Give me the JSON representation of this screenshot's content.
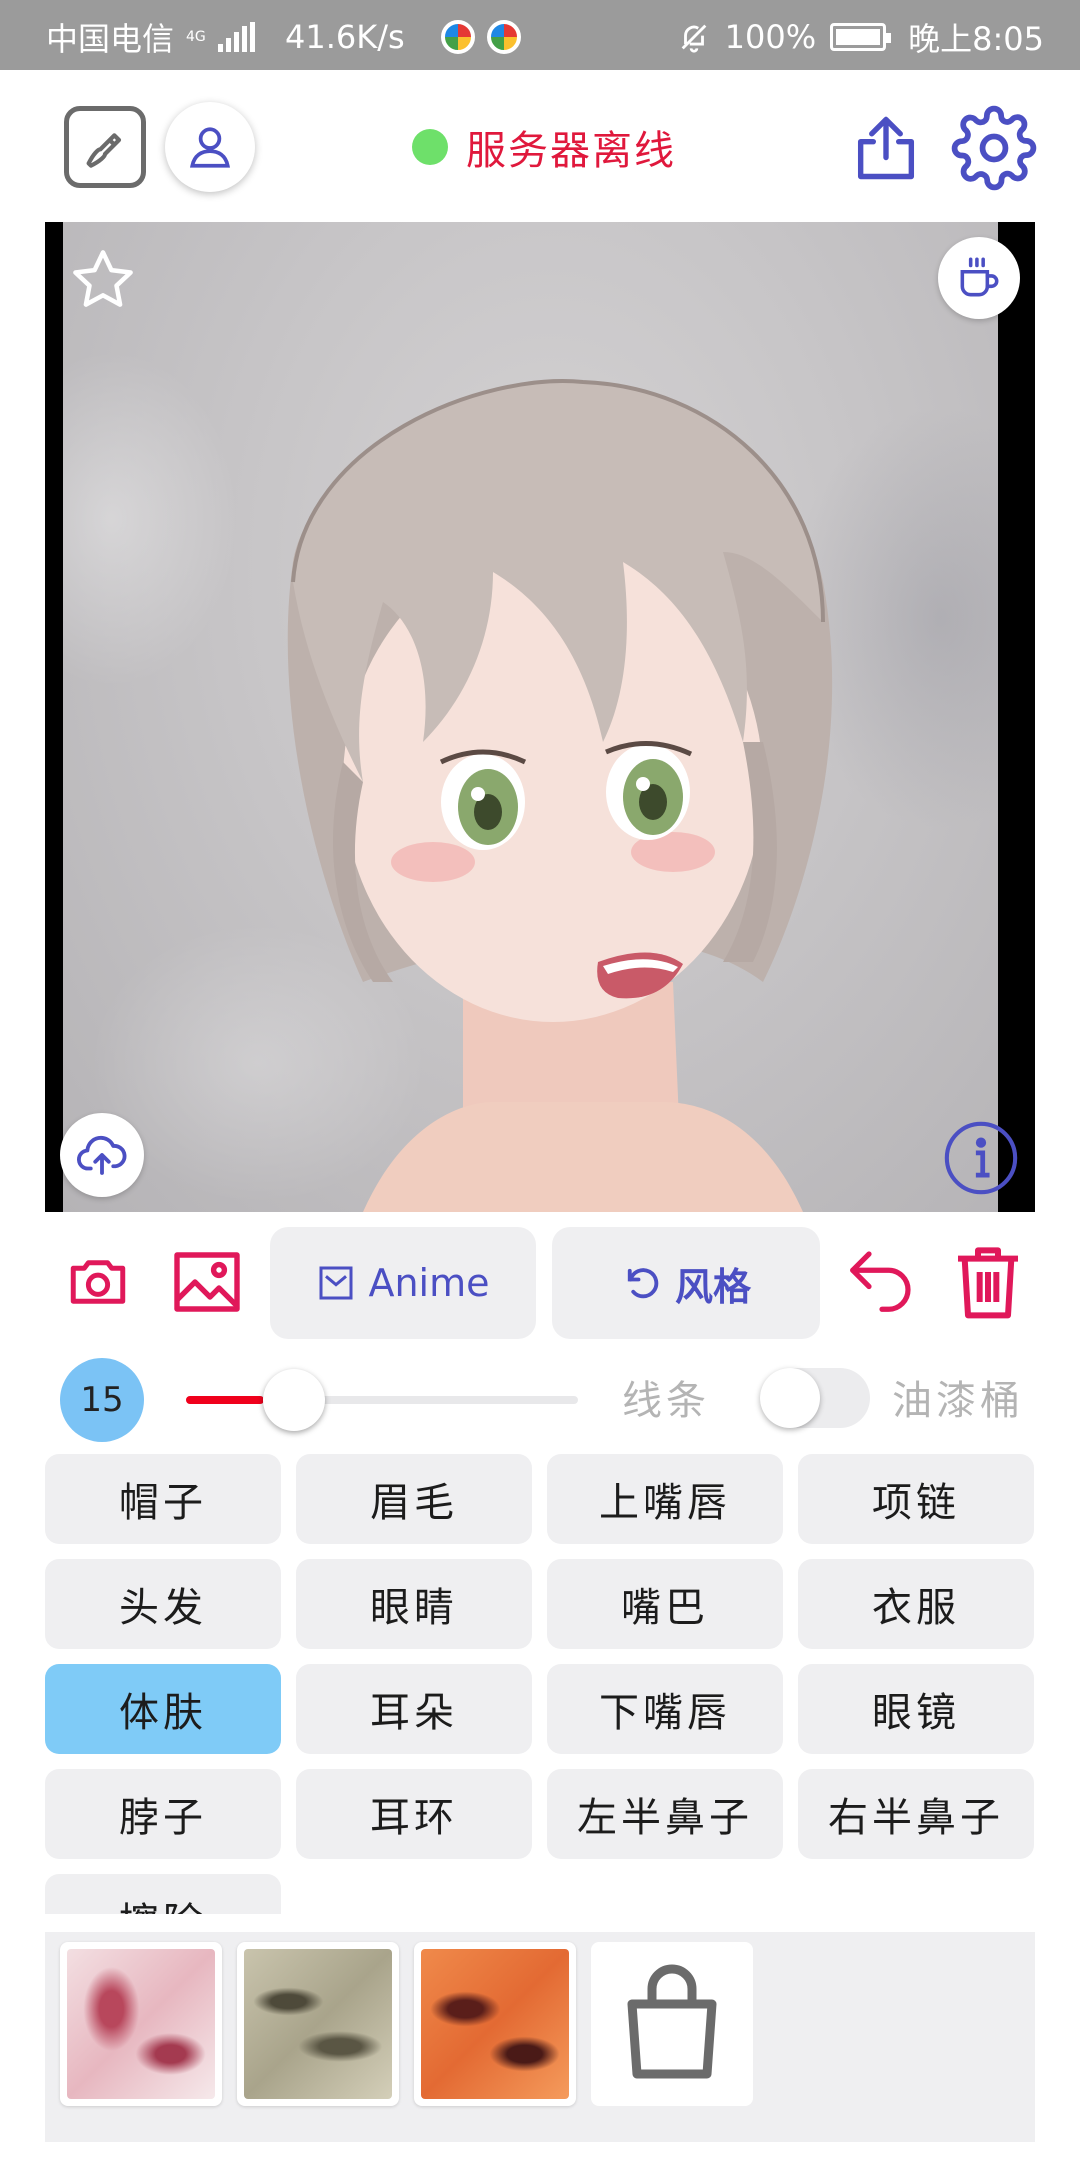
{
  "status_bar": {
    "carrier": "中国电信",
    "network_badge": "4G",
    "speed": "41.6K/s",
    "battery": "100%",
    "time": "晚上8:05"
  },
  "toolbar": {
    "server_status": "服务器离线",
    "status_color": "#6ee06a",
    "status_text_color": "#e0183c"
  },
  "tools": {
    "anime_label": "Anime",
    "style_label": "风格",
    "accent_color": "#e0185a",
    "brand_color": "#4b4fc3"
  },
  "brush": {
    "size": "15",
    "slider_level": 0.2,
    "line_label": "线条",
    "bucket_label": "油漆桶",
    "bucket_enabled": false
  },
  "parts": [
    "帽子",
    "眉毛",
    "上嘴唇",
    "项链",
    "头发",
    "眼睛",
    "嘴巴",
    "衣服",
    "体肤",
    "耳朵",
    "下嘴唇",
    "眼镜",
    "脖子",
    "耳环",
    "左半鼻子",
    "右半鼻子",
    "擦除"
  ],
  "active_part": "体肤",
  "icons": {
    "edit": "edit-icon",
    "user": "user-icon",
    "share": "share-icon",
    "settings": "gear-icon",
    "favorite": "star-icon",
    "coffee": "coffee-icon",
    "upload": "cloud-upload-icon",
    "info": "info-icon",
    "camera": "camera-icon",
    "gallery": "image-icon",
    "undo": "undo-icon",
    "delete": "trash-icon",
    "shop": "shopping-bag-icon"
  }
}
